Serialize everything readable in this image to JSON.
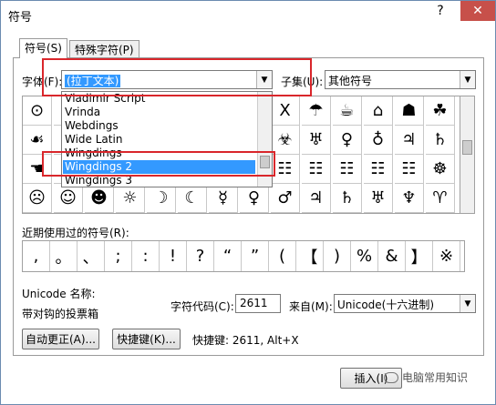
{
  "window": {
    "title": "符号",
    "help_glyph": "?",
    "close_glyph": "✕"
  },
  "tabs": [
    {
      "label": "符号(S)",
      "active": true
    },
    {
      "label": "特殊字符(P)",
      "active": false
    }
  ],
  "font": {
    "label": "字体(F):",
    "value": "(拉丁文本)"
  },
  "subset": {
    "label": "子集(U):",
    "value": "其他符号"
  },
  "font_dropdown": {
    "items": [
      "Vladimir Script",
      "Vrinda",
      "Webdings",
      "Wide Latin",
      "Wingdings",
      "Wingdings 2",
      "Wingdings 3"
    ],
    "selected": "Wingdings 2"
  },
  "symbol_grid": {
    "rows": [
      [
        "⊙",
        "",
        "",
        "",
        "",
        "",
        "",
        "☒",
        "Χ",
        "☂",
        "☕",
        "⌂",
        "☗",
        "☘"
      ],
      [
        "☙",
        "",
        "",
        "",
        "",
        "",
        "",
        "☢",
        "☣",
        "♅",
        "♀",
        "♁",
        "♃",
        "♄"
      ],
      [
        "☚",
        "",
        "",
        "",
        "",
        "",
        "",
        "☷",
        "☷",
        "☷",
        "☷",
        "☷",
        "☷",
        "☸"
      ],
      [
        "☹",
        "☺",
        "☻",
        "☼",
        "☽",
        "☾",
        "☿",
        "♀",
        "♂",
        "♃",
        "♄",
        "♅",
        "♆",
        "♈"
      ]
    ]
  },
  "recent": {
    "label": "近期使用过的符号(R):",
    "symbols": [
      ",",
      "。",
      "、",
      ";",
      ":",
      "!",
      "?",
      "“",
      "”",
      "(",
      "【",
      ")",
      "%",
      "&",
      "】",
      "※"
    ]
  },
  "unicode_name": {
    "label": "Unicode 名称:",
    "value": "带对钩的投票箱"
  },
  "char_code": {
    "label": "字符代码(C):",
    "value": "2611"
  },
  "from": {
    "label": "来自(M):",
    "value": "Unicode(十六进制)"
  },
  "buttons": {
    "autocorrect": "自动更正(A)...",
    "shortcut_key": "快捷键(K)...",
    "insert": "插入(I)"
  },
  "shortcut_text": "快捷键: 2611, Alt+X",
  "watermark": "电脑常用知识",
  "colors": {
    "highlight": "#3399ff",
    "annotation_red": "#d9262b",
    "close_button": "#c7504a"
  }
}
